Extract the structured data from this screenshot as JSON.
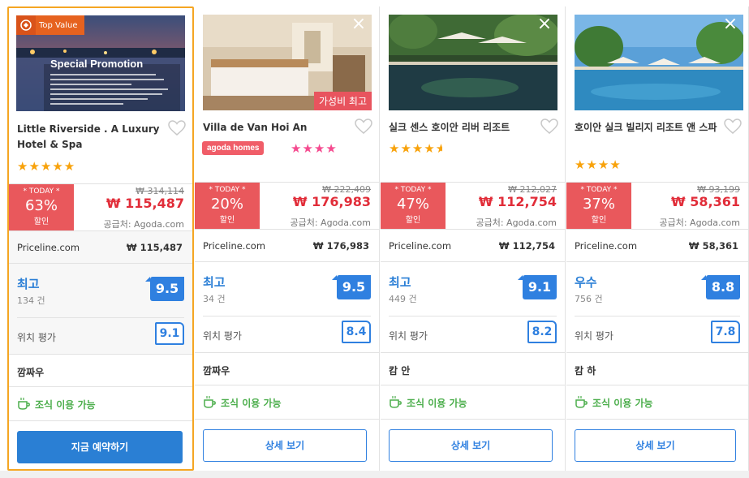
{
  "cards": [
    {
      "name": "Little Riverside . A Luxury Hotel & Spa",
      "badge": "Top Value",
      "promo_title": "Special Promotion",
      "stars": "★★★★★",
      "today_label": "* TODAY *",
      "discount_pct": "63%",
      "discount_word": "할인",
      "original_price": "₩ 314,114",
      "price": "₩ 115,487",
      "supplier": "공급처: Agoda.com",
      "alt_provider": "Priceline.com",
      "alt_price": "₩ 115,487",
      "rating_word": "최고",
      "review_count": "134 건",
      "score": "9.5",
      "location_label": "위치 평가",
      "location_score": "9.1",
      "area": "깜짜우",
      "breakfast": "조식 이용 가능",
      "button": "지금 예약하기"
    },
    {
      "name": "Villa de Van Hoi An",
      "value_tag": "가성비 최고",
      "agoda_homes": "agoda homes",
      "stars": "★★★★",
      "today_label": "* TODAY *",
      "discount_pct": "20%",
      "discount_word": "할인",
      "original_price": "₩ 222,409",
      "price": "₩ 176,983",
      "supplier": "공급처: Agoda.com",
      "alt_provider": "Priceline.com",
      "alt_price": "₩ 176,983",
      "rating_word": "최고",
      "review_count": "34 건",
      "score": "9.5",
      "location_label": "위치 평가",
      "location_score": "8.4",
      "area": "깜짜우",
      "breakfast": "조식 이용 가능",
      "button": "상세 보기"
    },
    {
      "name": "실크 센스 호이안 리버 리조트",
      "stars": "★★★★",
      "half_star": true,
      "today_label": "* TODAY *",
      "discount_pct": "47%",
      "discount_word": "할인",
      "original_price": "₩ 212,027",
      "price": "₩ 112,754",
      "supplier": "공급처: Agoda.com",
      "alt_provider": "Priceline.com",
      "alt_price": "₩ 112,754",
      "rating_word": "최고",
      "review_count": "449 건",
      "score": "9.1",
      "location_label": "위치 평가",
      "location_score": "8.2",
      "area": "캄 안",
      "breakfast": "조식 이용 가능",
      "button": "상세 보기"
    },
    {
      "name": "호이안 실크 빌리지 리조트 앤 스파",
      "stars": "★★★★",
      "today_label": "* TODAY *",
      "discount_pct": "37%",
      "discount_word": "할인",
      "original_price": "₩ 93,199",
      "price": "₩ 58,361",
      "supplier": "공급처: Agoda.com",
      "alt_provider": "Priceline.com",
      "alt_price": "₩ 58,361",
      "rating_word": "우수",
      "review_count": "756 건",
      "score": "8.8",
      "location_label": "위치 평가",
      "location_score": "7.8",
      "area": "캄 하",
      "breakfast": "조식 이용 가능",
      "button": "상세 보기"
    }
  ],
  "colors": {
    "accent_blue": "#2f80e0",
    "deal_red": "#e9585c",
    "price_red": "#e12d39",
    "star_gold": "#f8a20b",
    "star_pink": "#f54a8f",
    "breakfast_green": "#4cae4c",
    "selected_border": "#f5a623"
  },
  "icons": [
    "close-icon",
    "heart-icon",
    "coffee-cup-icon",
    "top-value-icon"
  ]
}
